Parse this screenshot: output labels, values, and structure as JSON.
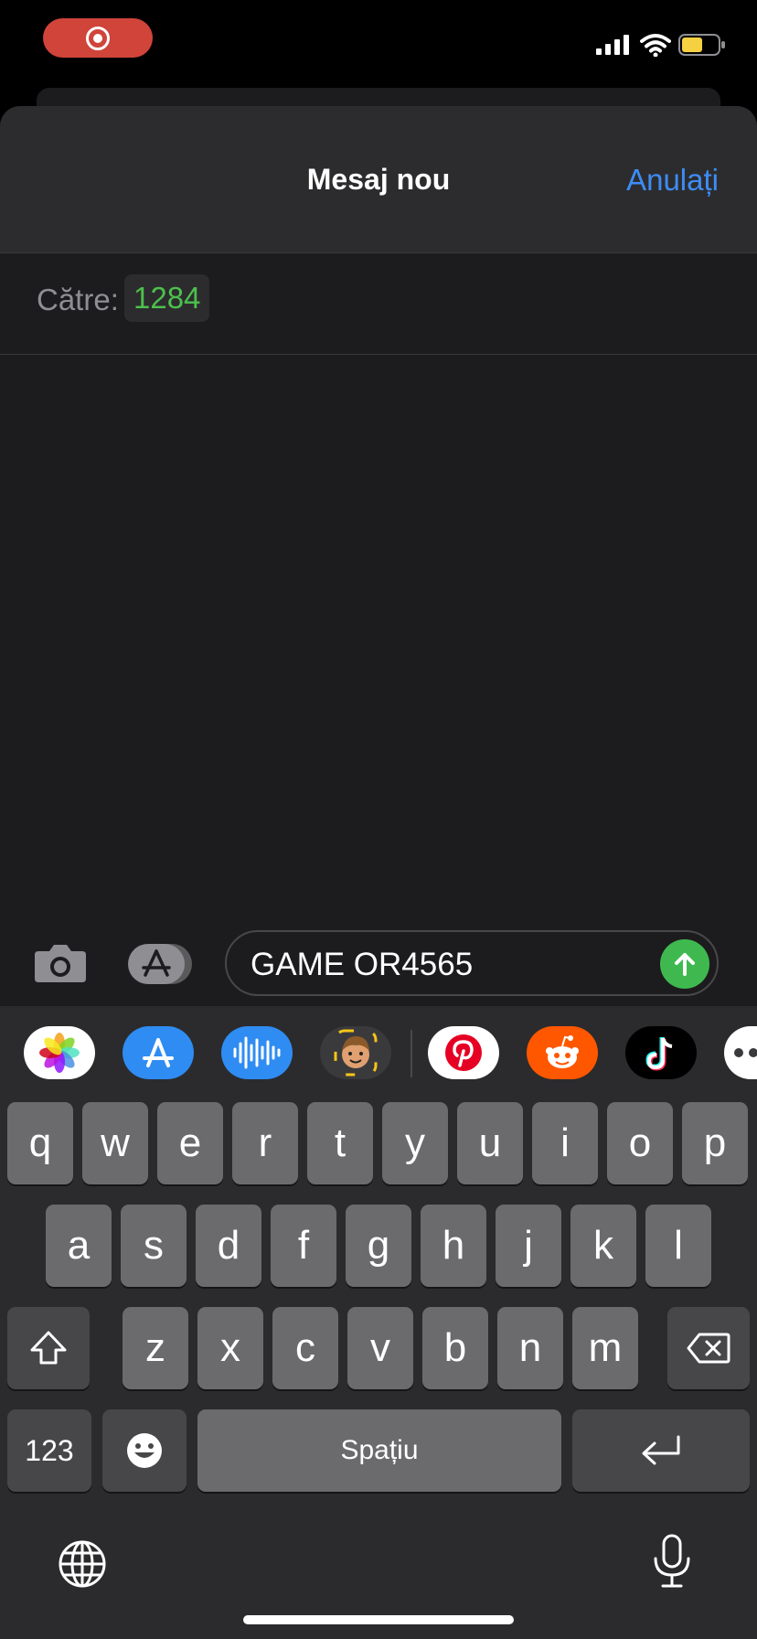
{
  "header": {
    "title": "Mesaj nou",
    "cancel_label": "Anulați"
  },
  "recipient": {
    "label": "Către:",
    "value": "1284"
  },
  "composer": {
    "text": "GAME OR4565"
  },
  "app_strip": [
    "photos-icon",
    "app-store-icon",
    "audio-message-icon",
    "memoji-icon",
    "pinterest-icon",
    "reddit-icon",
    "tiktok-icon",
    "more-apps-icon"
  ],
  "keyboard": {
    "row1": [
      "q",
      "w",
      "e",
      "r",
      "t",
      "y",
      "u",
      "i",
      "o",
      "p"
    ],
    "row2": [
      "a",
      "s",
      "d",
      "f",
      "g",
      "h",
      "j",
      "k",
      "l"
    ],
    "row3": [
      "z",
      "x",
      "c",
      "v",
      "b",
      "n",
      "m"
    ],
    "numbers_label": "123",
    "space_label": "Spațiu"
  },
  "colors": {
    "accent": "#3d8cf5",
    "recipient": "#4cc04c",
    "send": "#3fb94f",
    "recording": "#d0443a"
  }
}
